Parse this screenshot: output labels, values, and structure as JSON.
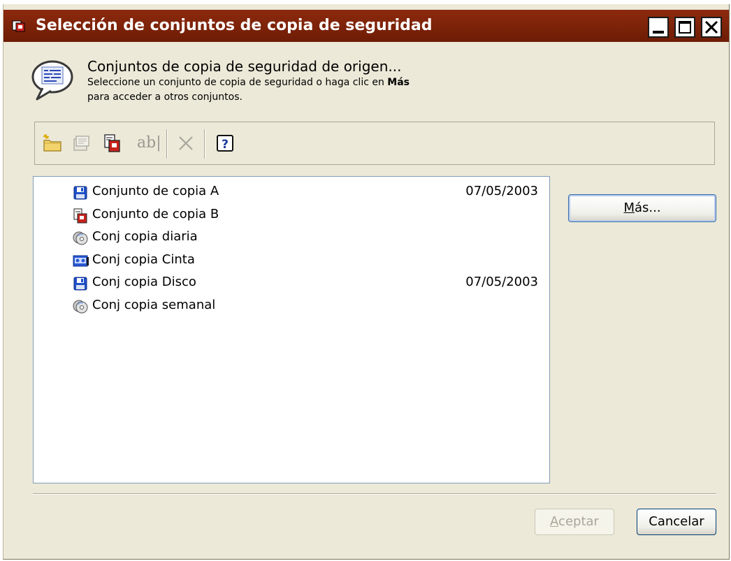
{
  "window": {
    "title": "Selección de conjuntos de copia de seguridad"
  },
  "header": {
    "title": "Conjuntos de copia de seguridad de origen...",
    "desc_line1_prefix": "Seleccione un conjunto de copia de seguridad o haga clic en ",
    "desc_line1_bold": "Más",
    "desc_line2": "para acceder a otros conjuntos."
  },
  "toolbar": {
    "items": [
      "new-folder-icon",
      "properties-icon",
      "backup-set-icon",
      "rename-icon",
      "delete-icon",
      "help-icon"
    ],
    "rename_glyph": "ab|"
  },
  "list": {
    "rows": [
      {
        "name": "Conjunto de copia A",
        "date": "07/05/2003",
        "icon": "floppy-disk-icon"
      },
      {
        "name": "Conjunto de copia B",
        "date": "",
        "icon": "backup-set-icon"
      },
      {
        "name": "Conj copia diaria",
        "date": "",
        "icon": "cd-disc-icon"
      },
      {
        "name": "Conj copia Cinta",
        "date": "",
        "icon": "tape-drive-icon"
      },
      {
        "name": "Conj copia Disco",
        "date": "07/05/2003",
        "icon": "floppy-disk-icon"
      },
      {
        "name": "Conj copia semanal",
        "date": "",
        "icon": "cd-disc-icon"
      }
    ]
  },
  "buttons": {
    "more_hotkey": "M",
    "more_rest": "ás...",
    "ok_hotkey": "A",
    "ok_rest": "ceptar",
    "cancel": "Cancelar"
  },
  "colors": {
    "titlebar": "#7a2208",
    "dialog_bg": "#ece9d8",
    "list_border": "#7f9db9"
  }
}
